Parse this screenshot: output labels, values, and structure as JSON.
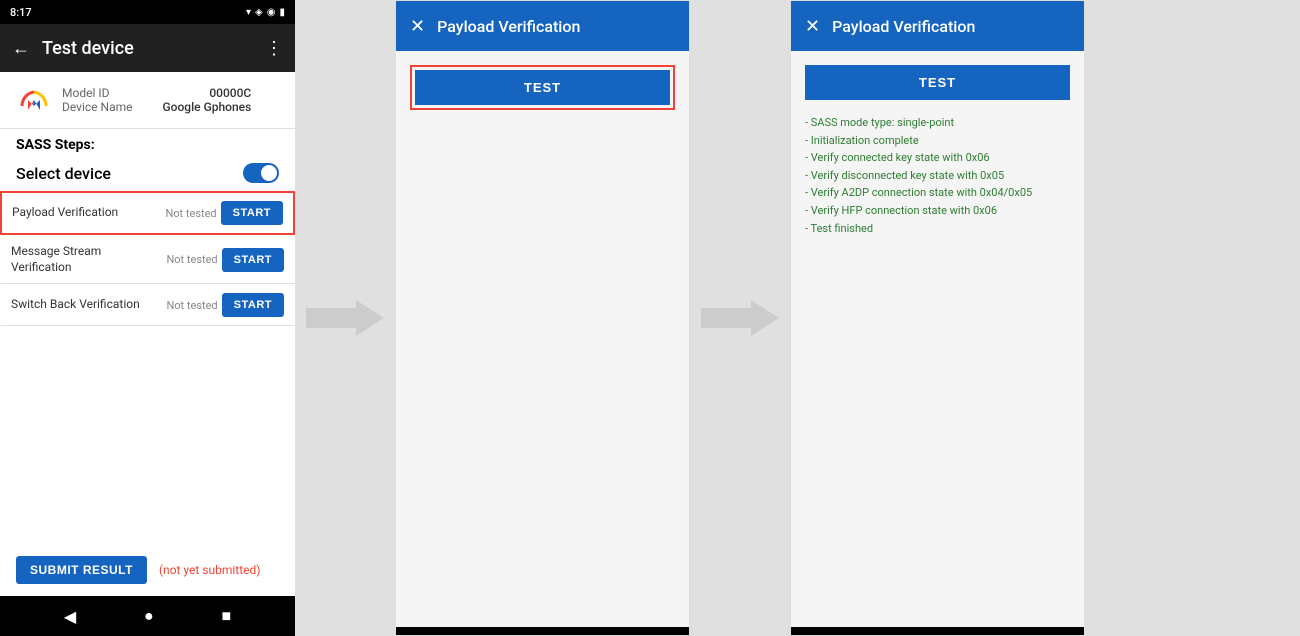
{
  "phone": {
    "status_bar": {
      "time": "8:17",
      "icons_right": "▾ ◈ ◉ ◉ •"
    },
    "app_bar": {
      "title": "Test device",
      "back_icon": "←",
      "menu_icon": "⋮"
    },
    "device_info": {
      "model_id_label": "Model ID",
      "model_id_value": "00000C",
      "device_name_label": "Device Name",
      "device_name_value": "Google Gphones"
    },
    "sass_label": "SASS Steps:",
    "select_device_label": "Select device",
    "tests": [
      {
        "name": "Payload Verification",
        "status": "Not tested",
        "btn_label": "START",
        "highlighted": true
      },
      {
        "name": "Message Stream Verification",
        "status": "Not tested",
        "btn_label": "START",
        "highlighted": false
      },
      {
        "name": "Switch Back Verification",
        "status": "Not tested",
        "btn_label": "START",
        "highlighted": false
      }
    ],
    "submit_btn_label": "SUBMIT RESULT",
    "not_submitted_label": "(not yet submitted)",
    "nav": {
      "back": "◀",
      "home": "●",
      "recents": "■"
    }
  },
  "dialog1": {
    "close_icon": "✕",
    "title": "Payload Verification",
    "test_btn_label": "TEST",
    "has_red_border": true,
    "log_lines": []
  },
  "dialog2": {
    "close_icon": "✕",
    "title": "Payload Verification",
    "test_btn_label": "TEST",
    "has_red_border": false,
    "log_lines": [
      "- SASS mode type: single-point",
      "- Initialization complete",
      "- Verify connected key state with 0x06",
      "- Verify disconnected key state with 0x05",
      "- Verify A2DP connection state with 0x04/0x05",
      "- Verify HFP connection state with 0x06",
      "- Test finished"
    ]
  },
  "colors": {
    "primary": "#1565C0",
    "danger": "#f44336",
    "success": "#2e7d32",
    "arrow": "#cccccc"
  }
}
